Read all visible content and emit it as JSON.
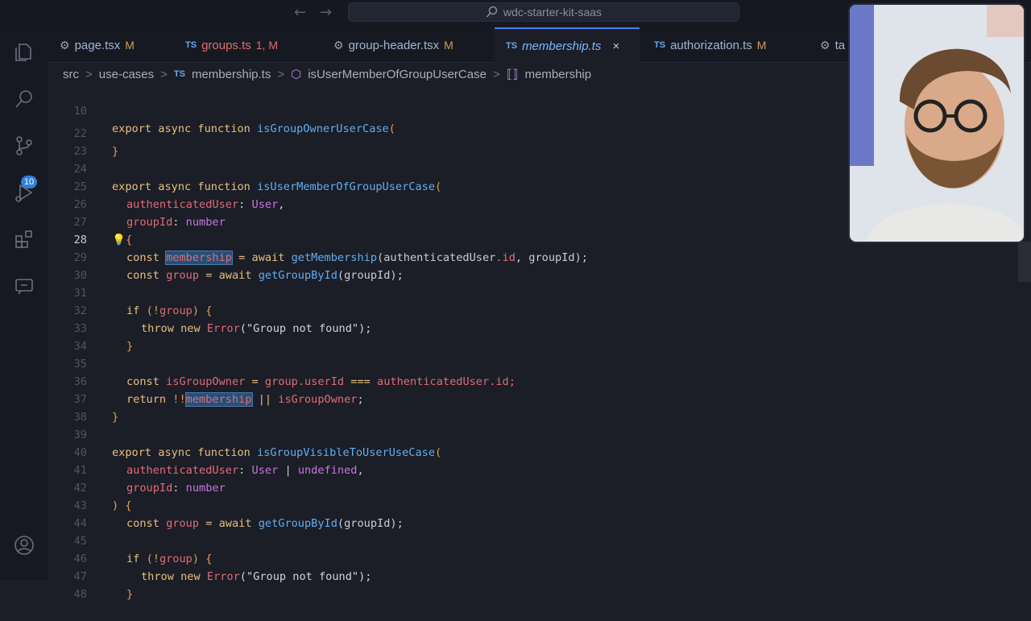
{
  "titlebar": {
    "search_text": "wdc-starter-kit-saas",
    "back_arrow": "←",
    "forward_arrow": "→"
  },
  "activity": {
    "scm_badge": "10"
  },
  "tabs": [
    {
      "label": "page.tsx",
      "status": "M"
    },
    {
      "label": "groups.ts",
      "status": "1, M"
    },
    {
      "label": "group-header.tsx",
      "status": "M"
    },
    {
      "label": "membership.ts",
      "status": "×"
    },
    {
      "label": "authorization.ts",
      "status": "M"
    },
    {
      "label": "ta",
      "status": ""
    }
  ],
  "tab_lang": "TS",
  "breadcrumb": {
    "src": "src",
    "folder": "use-cases",
    "file": "membership.ts",
    "function": "isUserMemberOfGroupUserCase",
    "symbol": "membership",
    "sep": ">"
  },
  "lines": [
    "10",
    "22",
    "23",
    "24",
    "25",
    "26",
    "27",
    "28",
    "29",
    "30",
    "31",
    "32",
    "33",
    "34",
    "35",
    "36",
    "37",
    "38",
    "39",
    "40",
    "41",
    "42",
    "43",
    "44",
    "45",
    "46",
    "47",
    "48"
  ],
  "code": {
    "l10": [
      "export async function",
      "isGroupOwnerUserCase",
      "("
    ],
    "l22": "}",
    "l24": [
      "export async function",
      "isUserMemberOfGroupUserCase",
      "("
    ],
    "l25": [
      "authenticatedUser",
      ":",
      "User",
      ","
    ],
    "l26": [
      "groupId",
      ":",
      "number"
    ],
    "l27": [
      "💡",
      "{"
    ],
    "l28": [
      "const",
      "membership",
      "=",
      "await",
      "getMembership",
      "(authenticatedUser",
      ".id",
      ", groupId);"
    ],
    "l29": [
      "const",
      "group",
      "=",
      "await",
      "getGroupById",
      "(groupId);"
    ],
    "l31": [
      "if",
      "(!",
      "group",
      ") {"
    ],
    "l32": [
      "throw new",
      "Error",
      "(\"Group not found\");"
    ],
    "l33": "}",
    "l35": [
      "const",
      "isGroupOwner",
      "=",
      "group",
      ".userId",
      "===",
      "authenticatedUser",
      ".id;"
    ],
    "l36": [
      "return",
      "!!",
      "membership",
      "||",
      "isGroupOwner",
      ";"
    ],
    "l37": "}",
    "l39": [
      "export async function",
      "isGroupVisibleToUserUseCase",
      "("
    ],
    "l40": [
      "authenticatedUser",
      ":",
      "User",
      "|",
      "undefined",
      ","
    ],
    "l41": [
      "groupId",
      ":",
      "number"
    ],
    "l42": ") {",
    "l43": [
      "const",
      "group",
      "=",
      "await",
      "getGroupById",
      "(groupId);"
    ],
    "l45": [
      "if",
      "(!",
      "group",
      ") {"
    ],
    "l46": [
      "throw new",
      "Error",
      "(\"Group not found\");"
    ],
    "l47": "}"
  }
}
